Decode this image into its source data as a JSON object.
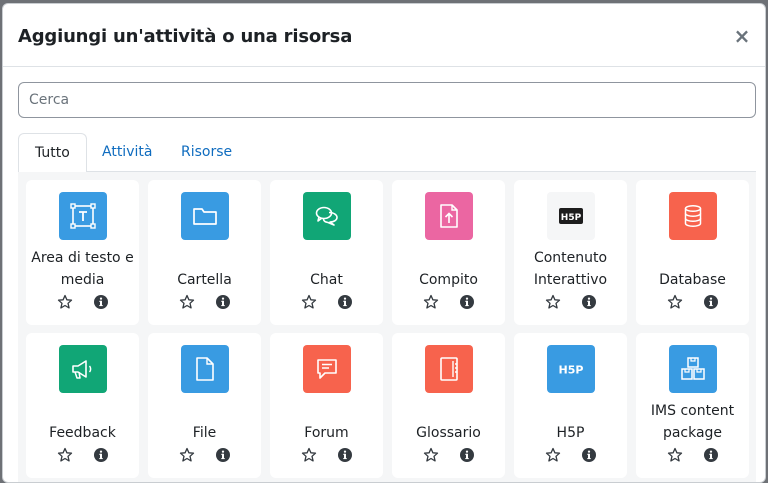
{
  "modal": {
    "title": "Aggiungi un'attività o una risorsa",
    "close_glyph": "×"
  },
  "search": {
    "placeholder": "Cerca",
    "value": ""
  },
  "tabs": [
    {
      "label": "Tutto",
      "active": true
    },
    {
      "label": "Attività",
      "active": false
    },
    {
      "label": "Risorse",
      "active": false
    }
  ],
  "colors": {
    "link": "#0f6cbf",
    "blue": "#399be2",
    "green": "#11a676",
    "pink": "#eb66a2",
    "red": "#f7634d",
    "h5p_dark": "#1d1d1d"
  },
  "cards": [
    {
      "line1": "Area di testo e",
      "line2": "media",
      "icon": "text-area-icon",
      "color": "#399be2"
    },
    {
      "line1": "",
      "line2": "Cartella",
      "icon": "folder-icon",
      "color": "#399be2"
    },
    {
      "line1": "",
      "line2": "Chat",
      "icon": "chat-bubbles-icon",
      "color": "#11a676"
    },
    {
      "line1": "",
      "line2": "Compito",
      "icon": "assignment-upload-icon",
      "color": "#eb66a2"
    },
    {
      "line1": "Contenuto",
      "line2": "Interattivo",
      "icon": "h5p-logo-icon",
      "color": "#f5f6f7"
    },
    {
      "line1": "",
      "line2": "Database",
      "icon": "database-icon",
      "color": "#f7634d"
    },
    {
      "line1": "",
      "line2": "Feedback",
      "icon": "megaphone-icon",
      "color": "#11a676"
    },
    {
      "line1": "",
      "line2": "File",
      "icon": "file-icon",
      "color": "#399be2"
    },
    {
      "line1": "",
      "line2": "Forum",
      "icon": "forum-icon",
      "color": "#f7634d"
    },
    {
      "line1": "",
      "line2": "Glossario",
      "icon": "glossary-icon",
      "color": "#f7634d"
    },
    {
      "line1": "",
      "line2": "H5P",
      "icon": "h5p-icon",
      "color": "#399be2"
    },
    {
      "line1": "IMS content",
      "line2": "package",
      "icon": "ims-package-icon",
      "color": "#399be2"
    }
  ]
}
